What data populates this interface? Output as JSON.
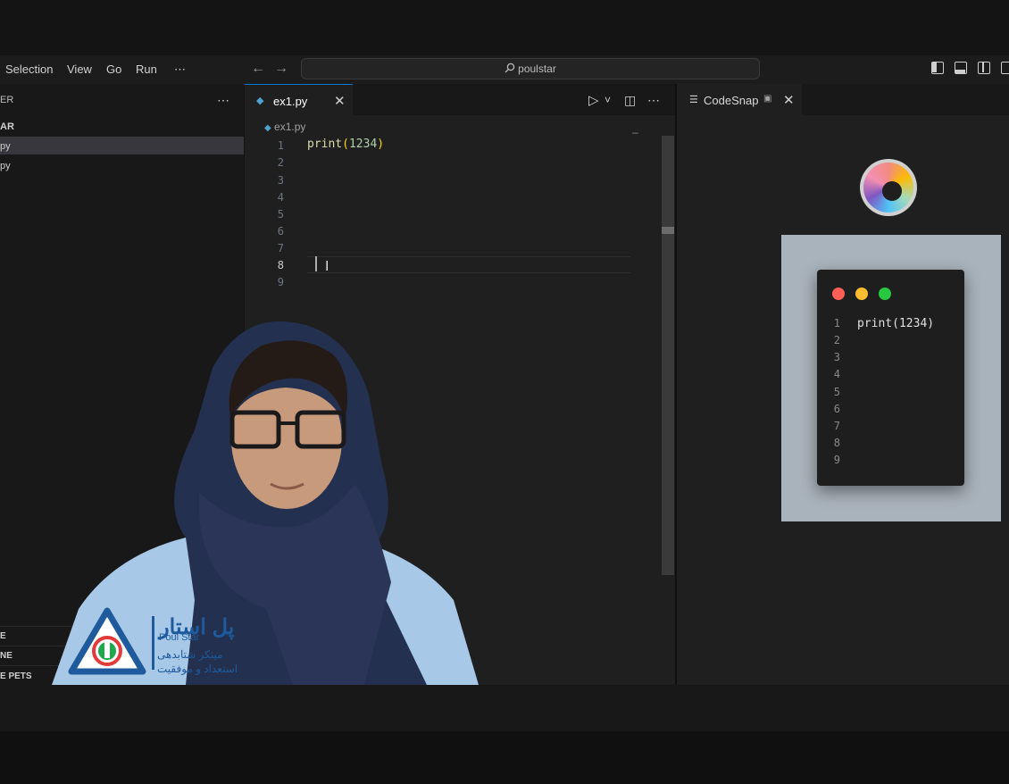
{
  "menubar": {
    "items": [
      "Selection",
      "View",
      "Go",
      "Run"
    ],
    "more": "⋯",
    "back": "←",
    "forward": "→",
    "search_text": "poulstar"
  },
  "sidebar": {
    "header": "ER",
    "more": "⋯",
    "section": "AR",
    "files": [
      "py",
      "py"
    ],
    "bottom_sections": [
      "E",
      "NE",
      "E PETS"
    ]
  },
  "editor": {
    "tab_label": "ex1.py",
    "tab_close": "✕",
    "breadcrumb": "ex1.py",
    "line_numbers": [
      "1",
      "2",
      "3",
      "4",
      "5",
      "6",
      "7",
      "8",
      "9"
    ],
    "code": {
      "func": "print",
      "open": "(",
      "arg": "1234",
      "close": ")"
    },
    "run": "▷",
    "run_menu": "˅",
    "split": "◫",
    "more": "⋯",
    "fold": "–"
  },
  "codesnap": {
    "tab_label": "CodeSnap",
    "tab_close": "✕",
    "line_numbers": [
      "1",
      "2",
      "3",
      "4",
      "5",
      "6",
      "7",
      "8",
      "9"
    ],
    "code": "print(1234)",
    "dot_colors": [
      "#ff5f57",
      "#febc2e",
      "#28c840"
    ]
  },
  "logo": {
    "title_fa": "پل استار",
    "title_en": "Poul Star",
    "tagline_1": "مینکر شتابدهی",
    "tagline_2": "استعداد و موفقیت"
  }
}
